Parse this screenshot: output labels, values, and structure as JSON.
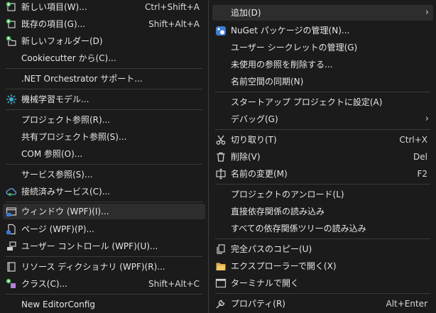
{
  "left_menu": {
    "items": [
      {
        "label": "新しい項目(W)...",
        "shortcut": "Ctrl+Shift+A"
      },
      {
        "label": "既存の項目(G)...",
        "shortcut": "Shift+Alt+A"
      },
      {
        "label": "新しいフォルダー(D)",
        "shortcut": ""
      },
      {
        "label": "Cookiecutter から(C)...",
        "shortcut": ""
      },
      {
        "label": ".NET Orchestrator サポート...",
        "shortcut": ""
      },
      {
        "label": "機械学習モデル...",
        "shortcut": ""
      },
      {
        "label": "プロジェクト参照(R)...",
        "shortcut": ""
      },
      {
        "label": "共有プロジェクト参照(S)...",
        "shortcut": ""
      },
      {
        "label": "COM 参照(O)...",
        "shortcut": ""
      },
      {
        "label": "サービス参照(S)...",
        "shortcut": ""
      },
      {
        "label": "接続済みサービス(C)...",
        "shortcut": ""
      },
      {
        "label": "ウィンドウ (WPF)(I)...",
        "shortcut": ""
      },
      {
        "label": "ページ (WPF)(P)...",
        "shortcut": ""
      },
      {
        "label": "ユーザー コントロール (WPF)(U)...",
        "shortcut": ""
      },
      {
        "label": "リソース ディクショナリ (WPF)(R)...",
        "shortcut": ""
      },
      {
        "label": "クラス(C)...",
        "shortcut": "Shift+Alt+C"
      },
      {
        "label": "New EditorConfig",
        "shortcut": ""
      }
    ]
  },
  "right_menu": {
    "items": [
      {
        "label": "追加(D)",
        "shortcut": ""
      },
      {
        "label": "NuGet パッケージの管理(N)...",
        "shortcut": ""
      },
      {
        "label": "ユーザー シークレットの管理(G)",
        "shortcut": ""
      },
      {
        "label": "未使用の参照を削除する...",
        "shortcut": ""
      },
      {
        "label": "名前空間の同期(N)",
        "shortcut": ""
      },
      {
        "label": "スタートアップ プロジェクトに設定(A)",
        "shortcut": ""
      },
      {
        "label": "デバッグ(G)",
        "shortcut": ""
      },
      {
        "label": "切り取り(T)",
        "shortcut": "Ctrl+X"
      },
      {
        "label": "削除(V)",
        "shortcut": "Del"
      },
      {
        "label": "名前の変更(M)",
        "shortcut": "F2"
      },
      {
        "label": "プロジェクトのアンロード(L)",
        "shortcut": ""
      },
      {
        "label": "直接依存関係の読み込み",
        "shortcut": ""
      },
      {
        "label": "すべての依存関係ツリーの読み込み",
        "shortcut": ""
      },
      {
        "label": "完全パスのコピー(U)",
        "shortcut": ""
      },
      {
        "label": "エクスプローラーで開く(X)",
        "shortcut": ""
      },
      {
        "label": "ターミナルで開く",
        "shortcut": ""
      },
      {
        "label": "プロパティ(R)",
        "shortcut": "Alt+Enter"
      }
    ]
  }
}
